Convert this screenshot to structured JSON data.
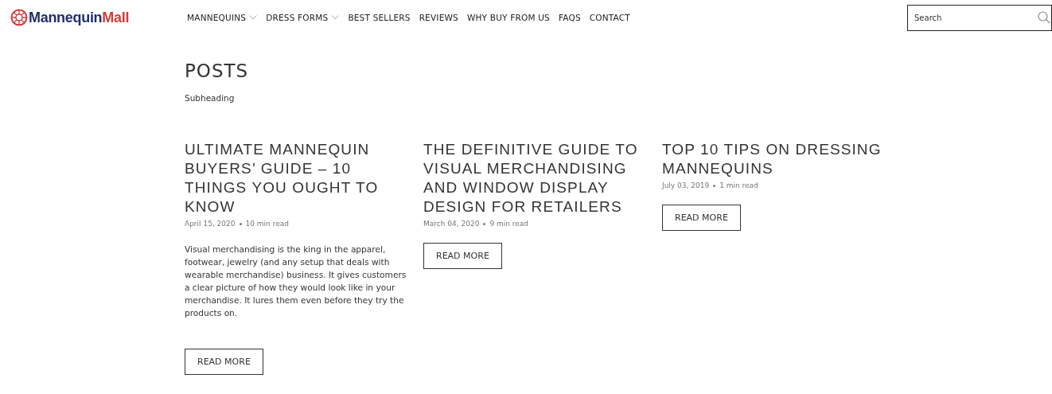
{
  "header": {
    "logo": {
      "part_1": "Mannequin",
      "part_2": "Mall"
    },
    "nav": [
      {
        "label": "MANNEQUINS",
        "dropdown": true
      },
      {
        "label": "DRESS FORMS",
        "dropdown": true
      },
      {
        "label": "BEST SELLERS",
        "dropdown": false
      },
      {
        "label": "REVIEWS",
        "dropdown": false
      },
      {
        "label": "WHY BUY FROM US",
        "dropdown": false
      },
      {
        "label": "FAQS",
        "dropdown": false
      },
      {
        "label": "CONTACT",
        "dropdown": false
      }
    ],
    "search": {
      "placeholder": "Search"
    }
  },
  "page": {
    "title": "POSTS",
    "subheading": "Subheading"
  },
  "posts": [
    {
      "title": "ULTIMATE MANNEQUIN BUYERS’ GUIDE – 10 THINGS YOU OUGHT TO KNOW",
      "date": "April 15, 2020",
      "read_time": "10 min read",
      "excerpt": "Visual merchandising is the king in the apparel, footwear, jewelry (and any setup that deals with wearable merchandise) business. It gives customers a clear picture of how they would look like in your merchandise. It lures them even before they try the products on.",
      "button": "READ MORE"
    },
    {
      "title": "THE DEFINITIVE GUIDE TO VISUAL MERCHANDISING AND WINDOW DISPLAY DESIGN FOR RETAILERS",
      "date": "March 04, 2020",
      "read_time": "9 min read",
      "button": "READ MORE"
    },
    {
      "title": "TOP 10 TIPS ON DRESSING MANNEQUINS",
      "date": "July 03, 2019",
      "read_time": "1 min read",
      "button": "READ MORE"
    }
  ]
}
